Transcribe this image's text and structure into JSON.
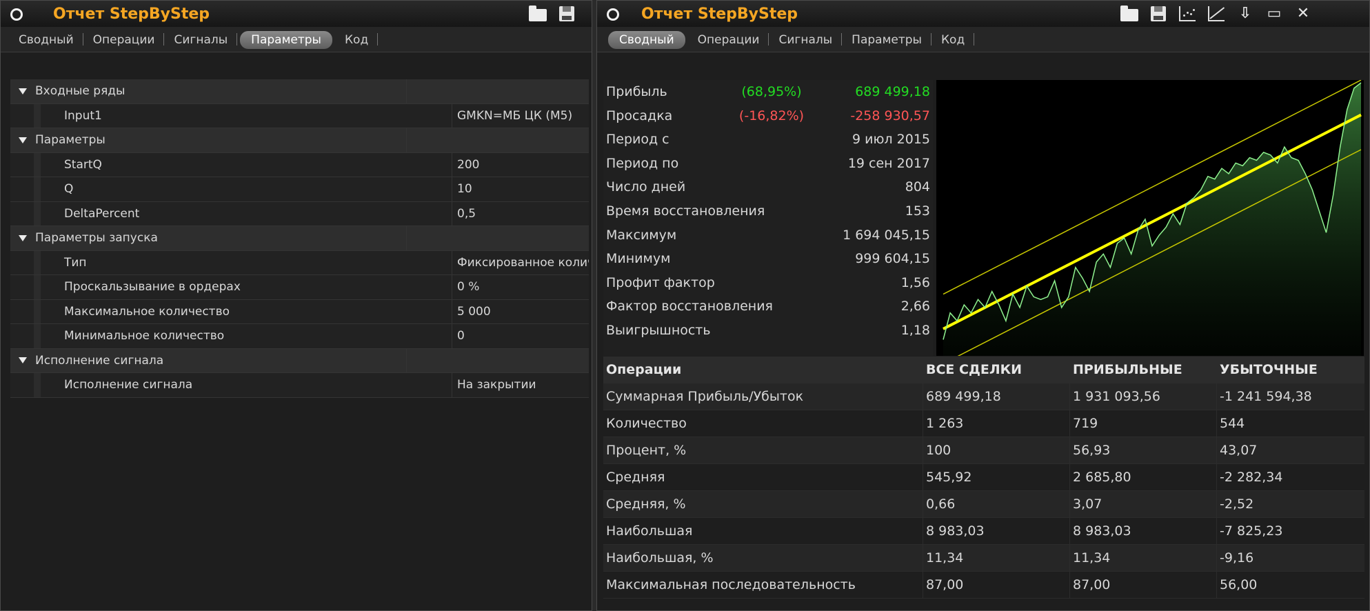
{
  "colors": {
    "accent": "#f5a623",
    "positive": "#22dd22",
    "negative": "#ff5555",
    "chart_line": "#8ff28f",
    "regression": "#ffff00"
  },
  "left": {
    "title": "Отчет StepByStep",
    "tabs": [
      "Сводный",
      "Операции",
      "Сигналы",
      "Параметры",
      "Код"
    ],
    "active_tab": "Параметры",
    "rows": [
      {
        "type": "group",
        "name": "Входные ряды",
        "value": ""
      },
      {
        "type": "item",
        "name": "Input1",
        "value": "GMKN=МБ ЦК (M5)"
      },
      {
        "type": "group",
        "name": "Параметры",
        "value": ""
      },
      {
        "type": "item",
        "name": "StartQ",
        "value": "200"
      },
      {
        "type": "item",
        "name": "Q",
        "value": "10"
      },
      {
        "type": "item",
        "name": "DeltaPercent",
        "value": "0,5"
      },
      {
        "type": "group",
        "name": "Параметры запуска",
        "value": ""
      },
      {
        "type": "item",
        "name": "Тип",
        "value": "Фиксированное количество"
      },
      {
        "type": "item",
        "name": "Проскальзывание в ордерах",
        "value": "0 %"
      },
      {
        "type": "item",
        "name": "Максимальное количество",
        "value": "5 000"
      },
      {
        "type": "item",
        "name": "Минимальное количество",
        "value": "0"
      },
      {
        "type": "group",
        "name": "Исполнение сигнала",
        "value": ""
      },
      {
        "type": "item",
        "name": "Исполнение сигнала",
        "value": "На закрытии"
      }
    ]
  },
  "right": {
    "title": "Отчет StepByStep",
    "tabs": [
      "Сводный",
      "Операции",
      "Сигналы",
      "Параметры",
      "Код"
    ],
    "active_tab": "Сводный",
    "stats": [
      {
        "label": "Прибыль",
        "pct": "(68,95%)",
        "value": "689 499,18",
        "tone": "pos"
      },
      {
        "label": "Просадка",
        "pct": "(-16,82%)",
        "value": "-258 930,57",
        "tone": "neg"
      },
      {
        "label": "Период с",
        "pct": "",
        "value": "9 июл 2015",
        "tone": ""
      },
      {
        "label": "Период по",
        "pct": "",
        "value": "19 сен 2017",
        "tone": ""
      },
      {
        "label": "Число дней",
        "pct": "",
        "value": "804",
        "tone": ""
      },
      {
        "label": "Время восстановления",
        "pct": "",
        "value": "153",
        "tone": ""
      },
      {
        "label": "Максимум",
        "pct": "",
        "value": "1 694 045,15",
        "tone": ""
      },
      {
        "label": "Минимум",
        "pct": "",
        "value": "999 604,15",
        "tone": ""
      },
      {
        "label": "Профит фактор",
        "pct": "",
        "value": "1,56",
        "tone": ""
      },
      {
        "label": "Фактор восстановления",
        "pct": "",
        "value": "2,66",
        "tone": ""
      },
      {
        "label": "Выигрышность",
        "pct": "",
        "value": "1,18",
        "tone": ""
      }
    ],
    "ops_header": [
      "Операции",
      "ВСЕ СДЕЛКИ",
      "ПРИБЫЛЬНЫЕ",
      "УБЫТОЧНЫЕ"
    ],
    "ops_rows": [
      [
        "Суммарная Прибыль/Убыток",
        "689 499,18",
        "1 931 093,56",
        "-1 241 594,38"
      ],
      [
        "Количество",
        "1 263",
        "719",
        "544"
      ],
      [
        "Процент, %",
        "100",
        "56,93",
        "43,07"
      ],
      [
        "Средняя",
        "545,92",
        "2 685,80",
        "-2 282,34"
      ],
      [
        "Средняя, %",
        "0,66",
        "3,07",
        "-2,52"
      ],
      [
        "Наибольшая",
        "8 983,03",
        "8 983,03",
        "-7 825,23"
      ],
      [
        "Наибольшая, %",
        "11,34",
        "11,34",
        "-9,16"
      ],
      [
        "Максимальная последовательность",
        "87,00",
        "87,00",
        "56,00"
      ]
    ]
  },
  "chart_data": {
    "type": "area",
    "x": [
      0,
      1,
      2,
      3,
      4,
      5,
      6,
      7,
      8,
      9,
      10,
      11,
      12,
      13,
      14,
      15,
      16,
      17,
      18,
      19,
      20,
      21,
      22,
      23,
      24,
      25,
      26,
      27,
      28,
      29,
      30,
      31,
      32,
      33,
      34,
      35,
      36,
      37,
      38,
      39,
      40,
      41,
      42,
      43,
      44,
      45,
      46,
      47,
      48,
      49,
      50,
      51,
      52,
      53,
      54,
      55,
      56,
      57,
      58,
      59,
      60
    ],
    "series": [
      {
        "values": [
          0.04,
          0.14,
          0.11,
          0.17,
          0.14,
          0.19,
          0.16,
          0.22,
          0.17,
          0.11,
          0.21,
          0.16,
          0.24,
          0.2,
          0.19,
          0.2,
          0.26,
          0.16,
          0.2,
          0.31,
          0.27,
          0.22,
          0.33,
          0.36,
          0.31,
          0.4,
          0.42,
          0.36,
          0.45,
          0.49,
          0.39,
          0.43,
          0.46,
          0.51,
          0.47,
          0.55,
          0.57,
          0.6,
          0.65,
          0.64,
          0.68,
          0.66,
          0.7,
          0.69,
          0.72,
          0.71,
          0.74,
          0.73,
          0.7,
          0.76,
          0.72,
          0.71,
          0.66,
          0.6,
          0.52,
          0.44,
          0.58,
          0.76,
          0.9,
          0.98,
          1.0
        ]
      }
    ],
    "trendline": [
      0.08,
      0.88
    ],
    "channel_offset": 0.13,
    "ylim": [
      0,
      1
    ],
    "grid": false
  }
}
